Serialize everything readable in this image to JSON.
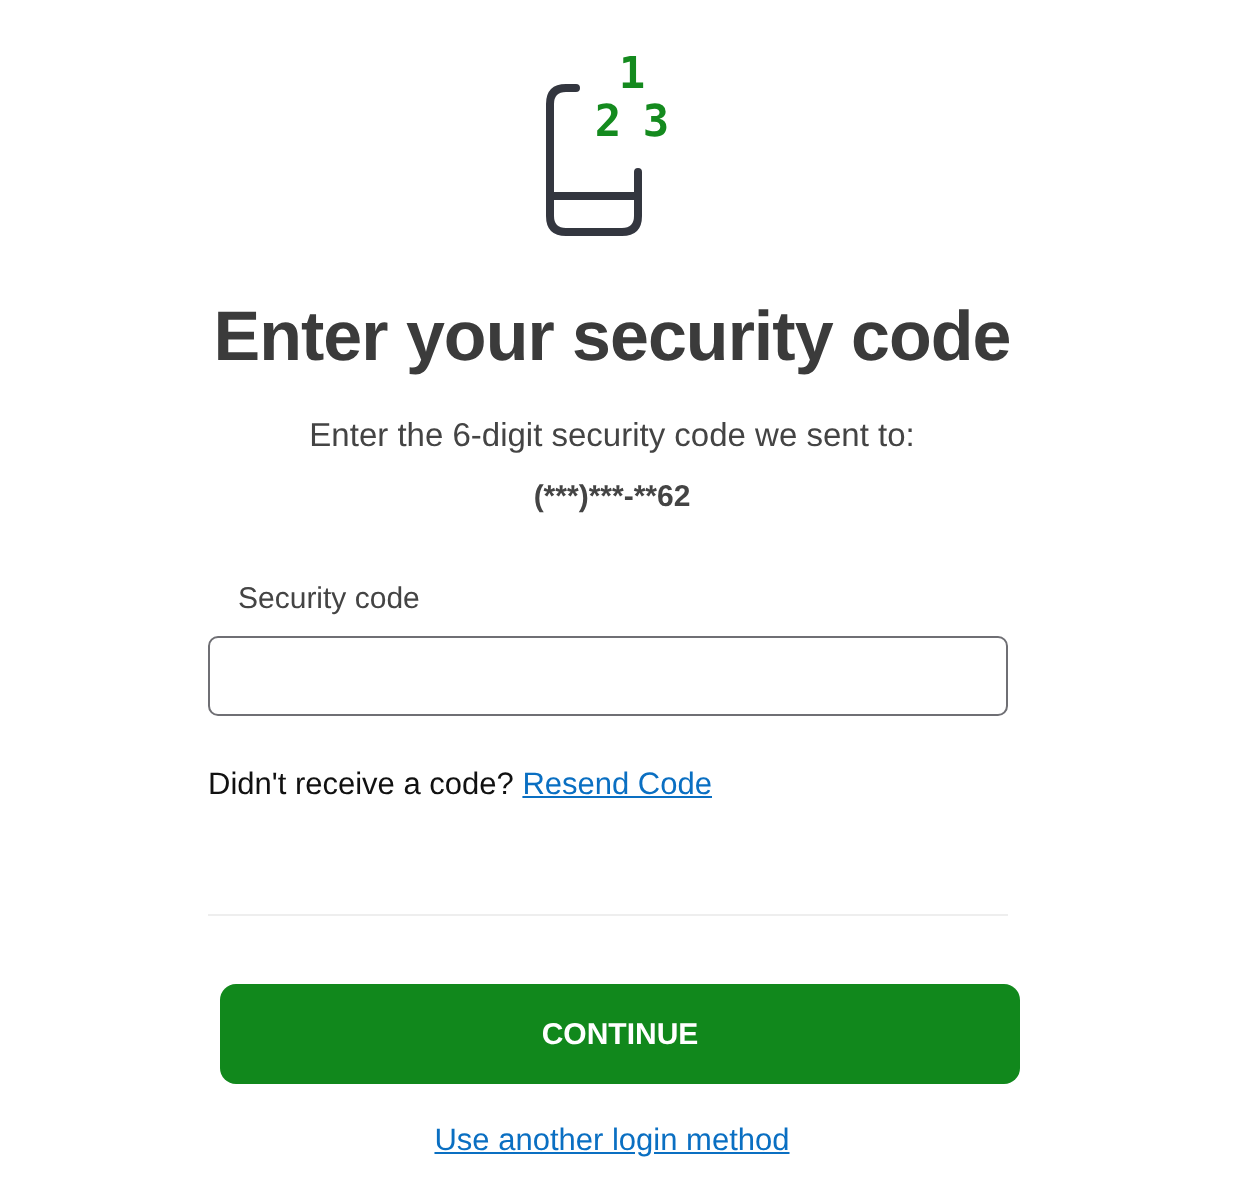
{
  "icon_digits": [
    "1",
    "2",
    "3"
  ],
  "title": "Enter your security code",
  "instruction": "Enter the 6-digit security code we sent to:",
  "masked_phone": "(***)***-**62",
  "field": {
    "label": "Security code"
  },
  "resend": {
    "prompt": "Didn't receive a code?",
    "link": "Resend Code"
  },
  "continue_button": "CONTINUE",
  "alt_link": "Use another login method"
}
